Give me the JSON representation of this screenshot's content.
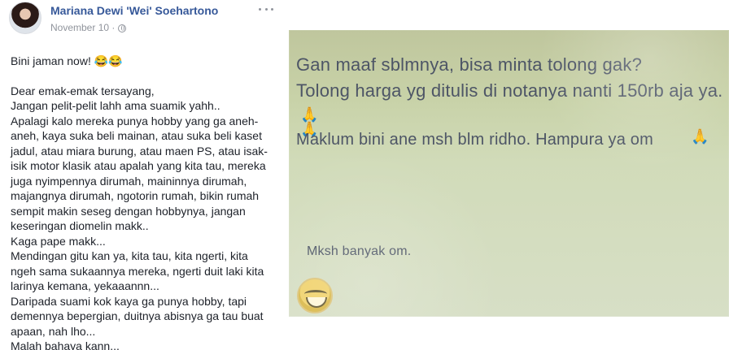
{
  "post": {
    "author": "Mariana Dewi 'Wei' Soehartono",
    "date": "November 10 ·",
    "paragraphs": [
      "Bini jaman now! 😂😂",
      "",
      "Dear emak-emak tersayang,",
      "Jangan pelit-pelit lahh ama suamik yahh..",
      "Apalagi kalo mereka punya hobby yang ga aneh-",
      "aneh, kaya suka beli mainan, atau suka beli kaset",
      "jadul, atau miara burung, atau maen PS, atau isak-",
      "isik motor klasik atau apalah yang kita tau, mereka",
      "juga nyimpennya dirumah, maininnya dirumah,",
      "majangnya dirumah, ngotorin rumah, bikin rumah",
      "sempit makin seseg dengan hobbynya, jangan",
      "keseringan diomelin makk..",
      "Kaga pape makk...",
      "Mendingan gitu kan ya, kita tau, kita ngerti, kita",
      "ngeh sama sukaannya mereka, ngerti duit laki kita",
      "larinya kemana, yekaaannn...",
      "Daripada suami kok kaya ga punya hobby, tapi",
      "demennya bepergian, duitnya abisnya ga tau buat",
      "apaan, nah lho...",
      "Malah bahaya kann..."
    ]
  },
  "photo": {
    "line1": "Gan maaf sblmnya, bisa minta tolong gak?",
    "line2": "Tolong harga yg ditulis di notanya nanti 150rb aja ya.",
    "line3": "Maklum bini ane msh blm ridho. Hampura ya om",
    "line4": "Mksh banyak om.",
    "emoji_praying": "🙏🙏",
    "emoji_praying_single": "🙏"
  }
}
